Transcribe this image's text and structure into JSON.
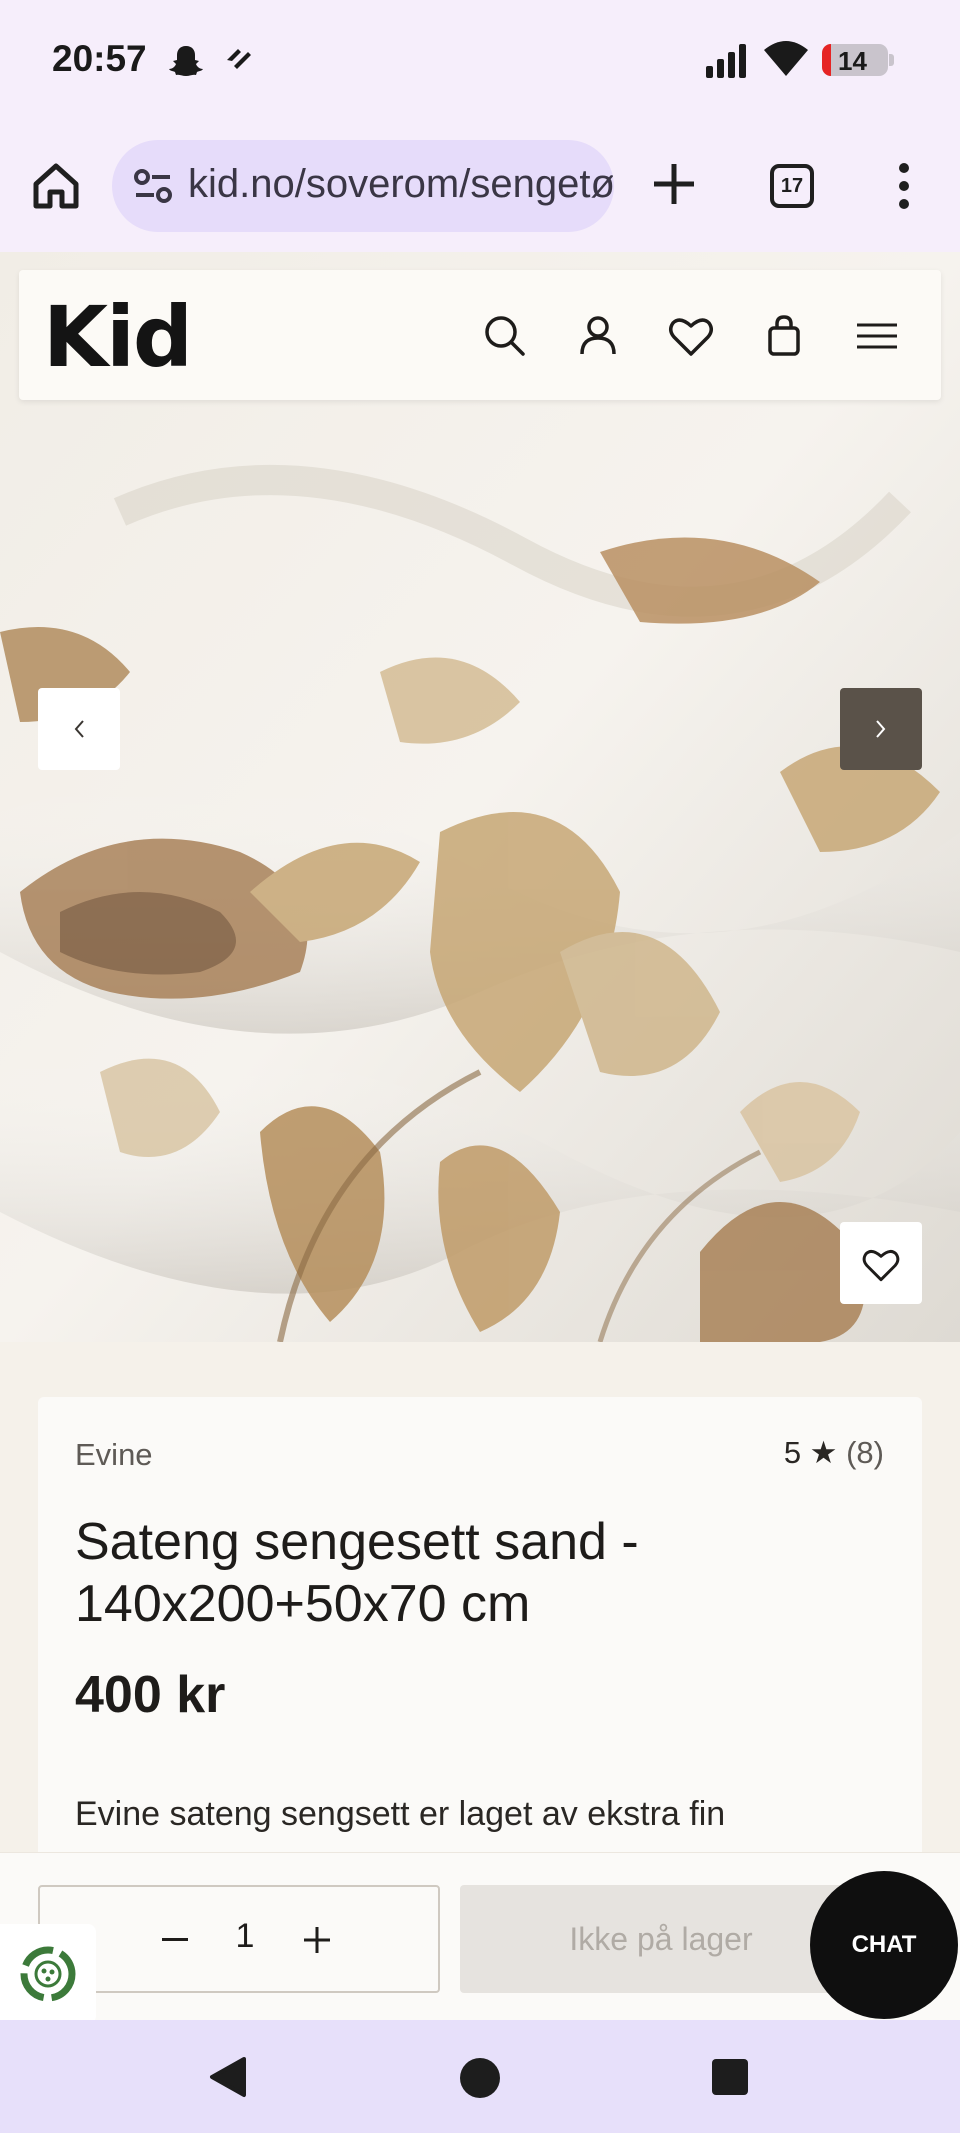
{
  "status_bar": {
    "time": "20:57",
    "battery_level": "14",
    "icons": [
      "snapchat-icon",
      "app-notification-icon",
      "signal-icon",
      "wifi-icon",
      "battery-icon"
    ]
  },
  "browser": {
    "url": "kid.no/soverom/sengetøy",
    "tab_count": "17",
    "icons": [
      "home-icon",
      "site-settings-icon",
      "new-tab-icon",
      "tabs-icon",
      "menu-icon"
    ]
  },
  "site": {
    "logo": "Kid",
    "header_icons": [
      "search-icon",
      "account-icon",
      "heart-icon",
      "bag-icon",
      "hamburger-icon"
    ]
  },
  "carousel": {
    "prev_label": "‹",
    "next_label": "›"
  },
  "product": {
    "brand": "Evine",
    "rating": "5 ★",
    "rating_count": "(8)",
    "title": "Sateng sengesett sand - 140x200+50x70 cm",
    "price": "400 kr",
    "description": "Evine sateng sengsett er laget av ekstra fin"
  },
  "purchase": {
    "quantity": "1",
    "minus_label": "−",
    "plus_label": "+",
    "stock_button": "Ikke på lager",
    "chat_label": "CHAT"
  },
  "colors": {
    "accent_dark": "#5a5249",
    "background": "#f5f1ea",
    "card": "#fbfaf8",
    "browser_bar": "#f6eefb",
    "url_pill": "#e6dcfa"
  }
}
